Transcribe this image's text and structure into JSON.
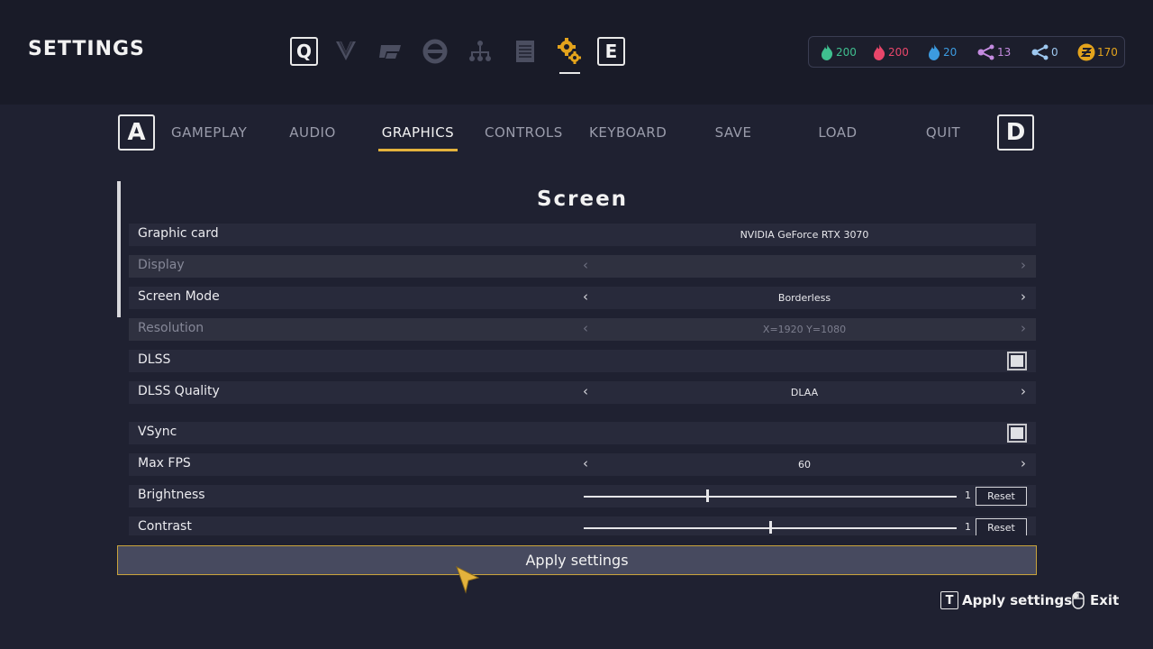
{
  "header": {
    "title": "SETTINGS",
    "prev_key": "Q",
    "next_key": "E",
    "nav_icons": [
      "chevron-down-icon",
      "cube-icon",
      "ring-icon",
      "tree-icon",
      "document-icon",
      "gears-icon"
    ],
    "active_nav_icon": "gears-icon"
  },
  "resources": [
    {
      "icon": "green-flame-icon",
      "value": "200",
      "color": "#3fbf8f"
    },
    {
      "icon": "red-flame-icon",
      "value": "200",
      "color": "#e8466a"
    },
    {
      "icon": "blue-flame-icon",
      "value": "20",
      "color": "#3c9be0"
    },
    {
      "icon": "purple-share-icon",
      "value": "13",
      "color": "#c48be0"
    },
    {
      "icon": "blue-share-icon",
      "value": "0",
      "color": "#9ec8f0"
    },
    {
      "icon": "gold-coin-icon",
      "value": "170",
      "color": "#e3a31c"
    }
  ],
  "tabs": {
    "prev_key": "A",
    "next_key": "D",
    "items": [
      {
        "label": "GAMEPLAY"
      },
      {
        "label": "AUDIO"
      },
      {
        "label": "GRAPHICS"
      },
      {
        "label": "CONTROLS"
      },
      {
        "label": "KEYBOARD"
      },
      {
        "label": "SAVE"
      },
      {
        "label": "LOAD"
      },
      {
        "label": "QUIT"
      }
    ],
    "active": "GRAPHICS"
  },
  "section": {
    "title": "Screen",
    "rows": [
      {
        "label": "Graphic card",
        "value": "NVIDIA GeForce RTX 3070",
        "type": "text"
      },
      {
        "label": "Display",
        "value": "",
        "type": "selector",
        "disabled": true
      },
      {
        "label": "Screen Mode",
        "value": "Borderless",
        "type": "selector"
      },
      {
        "label": "Resolution",
        "value": "X=1920 Y=1080",
        "type": "selector",
        "disabled": true
      },
      {
        "label": "DLSS",
        "type": "checkbox",
        "checked": false
      },
      {
        "label": "DLSS Quality",
        "value": "DLAA",
        "type": "selector"
      },
      {
        "label": "VSync",
        "type": "checkbox",
        "checked": false
      },
      {
        "label": "Max FPS",
        "value": "60",
        "type": "selector"
      },
      {
        "label": "Brightness",
        "type": "slider",
        "value": "1",
        "position": 0.33,
        "reset_label": "Reset"
      },
      {
        "label": "Contrast",
        "type": "slider",
        "value": "1",
        "position": 0.5,
        "reset_label": "Reset"
      }
    ]
  },
  "apply_button": {
    "label": "Apply settings"
  },
  "footer": {
    "apply_key": "T",
    "apply_label": "Apply settings",
    "exit_icon": "mouse-icon",
    "exit_label": "Exit"
  },
  "colors": {
    "accent": "#e3b23c",
    "background": "#1f2131"
  }
}
